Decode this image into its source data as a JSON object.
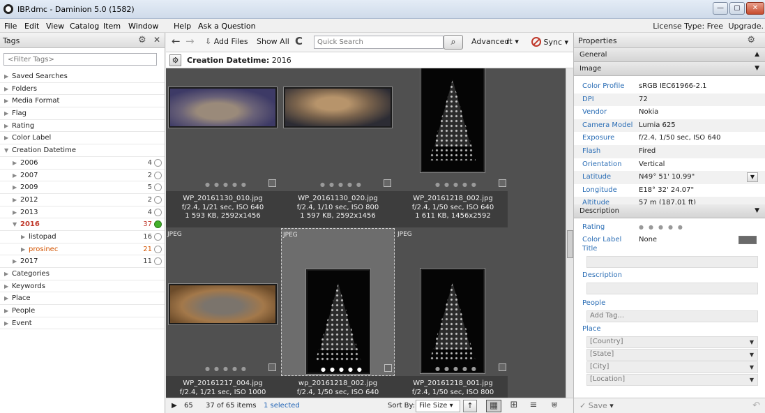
{
  "window": {
    "title": "IBP.dmc - Daminion 5.0 (1582)",
    "min": "—",
    "max": "▢",
    "close": "✕"
  },
  "menu": {
    "items": [
      "File",
      "Edit",
      "View",
      "Catalog",
      "Item",
      "Window",
      "Help",
      "Ask a Question"
    ],
    "license": "License Type: Free",
    "upgrade": "Upgrade."
  },
  "tags_panel": {
    "title": "Tags",
    "filter_placeholder": "<Filter Tags>",
    "rows": [
      {
        "label": "Saved Searches",
        "level": 0,
        "expanded": false
      },
      {
        "label": "Folders",
        "level": 0,
        "expanded": false
      },
      {
        "label": "Media Format",
        "level": 0,
        "expanded": false
      },
      {
        "label": "Flag",
        "level": 0,
        "expanded": false
      },
      {
        "label": "Rating",
        "level": 0,
        "expanded": false
      },
      {
        "label": "Color Label",
        "level": 0,
        "expanded": false
      },
      {
        "label": "Creation Datetime",
        "level": 0,
        "expanded": true
      },
      {
        "label": "2006",
        "level": 1,
        "count": "4"
      },
      {
        "label": "2007",
        "level": 1,
        "count": "2"
      },
      {
        "label": "2009",
        "level": 1,
        "count": "5"
      },
      {
        "label": "2012",
        "level": 1,
        "count": "2"
      },
      {
        "label": "2013",
        "level": 1,
        "count": "4"
      },
      {
        "label": "2016",
        "level": 1,
        "count": "37",
        "expanded": true,
        "style": "bold",
        "checked": true
      },
      {
        "label": "listopad",
        "level": 2,
        "count": "16"
      },
      {
        "label": "prosinec",
        "level": 2,
        "count": "21",
        "style": "orange"
      },
      {
        "label": "2017",
        "level": 1,
        "count": "11"
      },
      {
        "label": "Categories",
        "level": 0
      },
      {
        "label": "Keywords",
        "level": 0
      },
      {
        "label": "Place",
        "level": 0
      },
      {
        "label": "People",
        "level": 0
      },
      {
        "label": "Event",
        "level": 0
      }
    ]
  },
  "toolbar": {
    "back": "←",
    "forward": "→",
    "add_files": "Add Files",
    "show_all": "Show All",
    "refresh": "C",
    "search_placeholder": "Quick Search",
    "advanced": "Advanced",
    "sort_fragment": "rt",
    "sync": "Sync"
  },
  "filter_bar": {
    "label": "Creation Datetime:",
    "value": "2016"
  },
  "items": [
    {
      "name": "WP_20161130_010.jpg",
      "exif": "f/2.4, 1/21 sec, ISO 640",
      "info": "1 593 KB, 2592x1456",
      "photo": "cat1",
      "orientation": "landscape"
    },
    {
      "name": "WP_20161130_020.jpg",
      "exif": "f/2.4, 1/10 sec, ISO 800",
      "info": "1 597 KB, 2592x1456",
      "photo": "cat2",
      "orientation": "landscape"
    },
    {
      "name": "WP_20161218_002.jpg",
      "exif": "f/2.4, 1/50 sec, ISO 640",
      "info": "1 611 KB, 1456x2592",
      "photo": "tree",
      "orientation": "portrait"
    },
    {
      "name": "WP_20161217_004.jpg",
      "exif": "f/2.4, 1/21 sec, ISO 1000",
      "info": "",
      "photo": "cat3",
      "orientation": "landscape",
      "format": "JPEG"
    },
    {
      "name": "wp_20161218_002.jpg",
      "exif": "f/2.4, 1/50 sec, ISO 640",
      "info": "",
      "photo": "tree",
      "orientation": "portrait",
      "format": "JPEG",
      "selected": true
    },
    {
      "name": "WP_20161218_001.jpg",
      "exif": "f/2.4, 1/50 sec, ISO 800",
      "info": "",
      "photo": "tree",
      "orientation": "portrait",
      "format": "JPEG"
    }
  ],
  "status": {
    "play": "▶",
    "count": "65",
    "items_text": "37 of 65 items",
    "selected_text": "1 selected",
    "sort_by": "Sort By:",
    "sort_value": "File Size"
  },
  "properties": {
    "title": "Properties",
    "sections": {
      "general": "General",
      "image": "Image",
      "description": "Description"
    },
    "image": [
      {
        "k": "Color Profile",
        "v": "sRGB IEC61966-2.1"
      },
      {
        "k": "DPI",
        "v": "72"
      },
      {
        "k": "Vendor",
        "v": "Nokia"
      },
      {
        "k": "Camera Model",
        "v": "Lumia 625"
      },
      {
        "k": "Exposure",
        "v": "f/2.4, 1/50 sec, ISO 640"
      },
      {
        "k": "Flash",
        "v": "Fired"
      },
      {
        "k": "Orientation",
        "v": "Vertical"
      },
      {
        "k": "Latitude",
        "v": "N49° 51' 10.99\""
      },
      {
        "k": "Longitude",
        "v": "E18° 32' 24.07\""
      },
      {
        "k": "Altitude",
        "v": "57 m (187.01 ft)"
      }
    ],
    "description": {
      "rating": "Rating",
      "color_label": "Color Label",
      "color_value": "None",
      "title": "Title",
      "description": "Description",
      "people": "People",
      "add_tag": "Add Tag...",
      "place": "Place",
      "country": "[Country]",
      "state": "[State]",
      "city": "[City]",
      "location": "[Location]"
    },
    "save": "Save"
  }
}
